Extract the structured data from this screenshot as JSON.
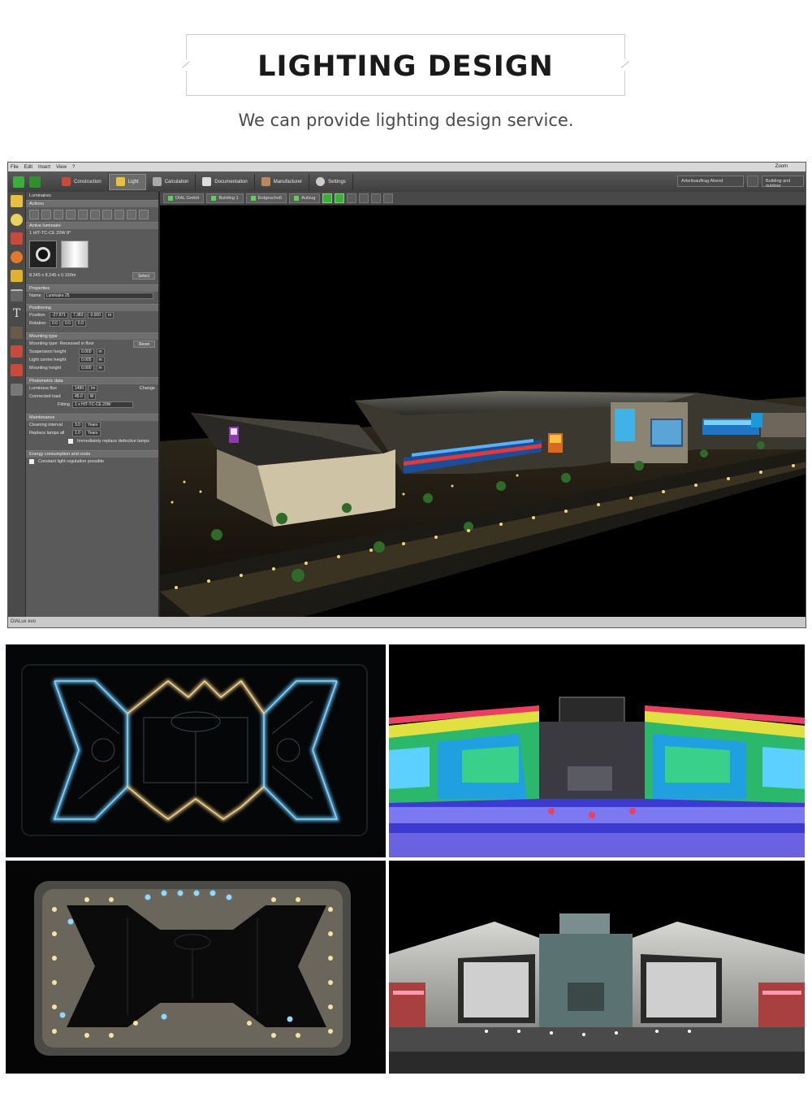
{
  "header": {
    "title": "LIGHTING DESIGN",
    "subtitle": "We can provide lighting design service."
  },
  "app": {
    "menu": [
      "File",
      "Edit",
      "Insert",
      "View",
      "?"
    ],
    "zoom_label": "Zoom",
    "ribbon_tabs": [
      {
        "label": "Construction",
        "icon": "construction-icon",
        "color": "#c84a3a"
      },
      {
        "label": "Light",
        "icon": "light-icon",
        "color": "#e8c040",
        "active": true
      },
      {
        "label": "Calculation",
        "icon": "calculation-icon",
        "color": "#aaaaaa"
      },
      {
        "label": "Documentation",
        "icon": "documentation-icon",
        "color": "#dddddd"
      },
      {
        "label": "Manufacturer",
        "icon": "manufacturer-icon",
        "color": "#b98a5a"
      },
      {
        "label": "Settings",
        "icon": "gear-icon",
        "color": "#cccccc"
      }
    ],
    "ribbon_right": {
      "dropdown": "Arbeitsauftrag Abend",
      "button": "Building and outdoor"
    },
    "left_strip_icons": [
      {
        "icon": "lamp-icon",
        "color": "#e8c040"
      },
      {
        "icon": "bulb-icon",
        "color": "#e8d060"
      },
      {
        "icon": "spot-icon",
        "color": "#c84a3a"
      },
      {
        "icon": "color-icon",
        "color": "#e07a2a"
      },
      {
        "icon": "layer-icon",
        "color": "#e0b030"
      },
      {
        "icon": "measure-icon",
        "color": "#bbbbbb"
      },
      {
        "icon": "text-icon",
        "color": "#dddddd"
      },
      {
        "icon": "dots-icon",
        "color": "#aa8866"
      },
      {
        "icon": "grid-icon",
        "color": "#c84a3a"
      },
      {
        "icon": "image-icon",
        "color": "#c84a3a"
      },
      {
        "icon": "chair-icon",
        "color": "#bbbbbb"
      }
    ],
    "panel": {
      "title": "Luminaires",
      "actions": "Actions",
      "active_luminaire": "Active luminaire",
      "luminaire_name": "1 HIT-TC-CE 20W 8°",
      "dimensions": "8.245 x 8.245 x 0.150m",
      "select": "Select",
      "properties": "Properties",
      "name_label": "Name",
      "name_value": "Luminaire 25",
      "positioning": "Positioning",
      "position_label": "Position",
      "position_values": [
        "-27.871",
        "7.383",
        "0.000"
      ],
      "rotation_label": "Rotation",
      "rotation_values": [
        "0.0",
        "0.0",
        "0.0"
      ],
      "unit_m": "m",
      "mounting_type": "Mounting type",
      "mounting_value": "Mounting type: Recessed in floor",
      "reset": "Reset",
      "suspension_label": "Suspension height",
      "suspension_value": "0.000",
      "light_centre_label": "Light centre height",
      "light_centre_value": "0.005",
      "mounting_height_label": "Mounting height",
      "mounting_height_value": "0.000",
      "photometric": "Photometric data",
      "flux_label": "Luminous flux",
      "flux_value": "1490",
      "flux_unit": "lm",
      "change": "Change",
      "load_label": "Connected load",
      "load_value": "45.0",
      "load_unit": "W",
      "fitting_label": "Fitting",
      "fitting_value": "1 x HIT-TC-CE 20W",
      "maintenance": "Maintenance",
      "cleaning_label": "Cleaning interval",
      "cleaning_value": "3.0",
      "years": "Years",
      "replace_label": "Replace lamps all",
      "replace_value": "1.0",
      "replace_check": "Immediately replace defective lamps",
      "energy": "Energy consumption and costs",
      "constant_check": "Constant light regulation possible"
    },
    "viewbar": [
      "DIAL GmbH",
      "Building 1",
      "Erdgeschoß",
      "Aufzug"
    ],
    "status": "DIALux evo"
  }
}
